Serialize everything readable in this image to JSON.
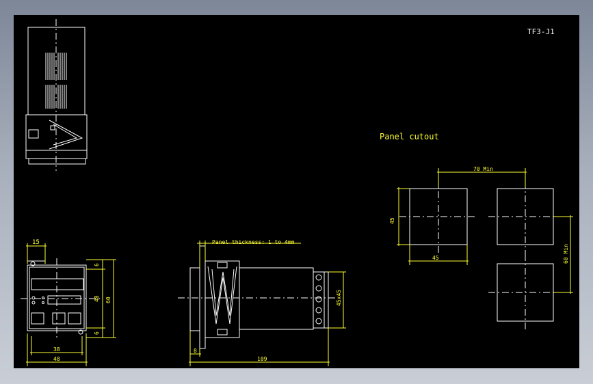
{
  "drawing": {
    "title": "TF3-J1",
    "cutout_label": "Panel cutout",
    "panel_note": "Panel thickness: 1 to 4mm"
  },
  "dims": {
    "front_15": "15",
    "front_6_top": "6",
    "front_48_v": "48",
    "front_60": "60",
    "front_6_bot": "6",
    "front_38": "38",
    "front_48_h": "48",
    "side_8": "8",
    "side_109": "109",
    "side_45x45": "45x45",
    "cutout_70": "70 Min",
    "cutout_45_v": "45",
    "cutout_45_h": "45",
    "cutout_60": "60 Min"
  },
  "colors": {
    "canvas": "#000000",
    "geometry": "#ffffff",
    "dimension": "#ffff33"
  }
}
